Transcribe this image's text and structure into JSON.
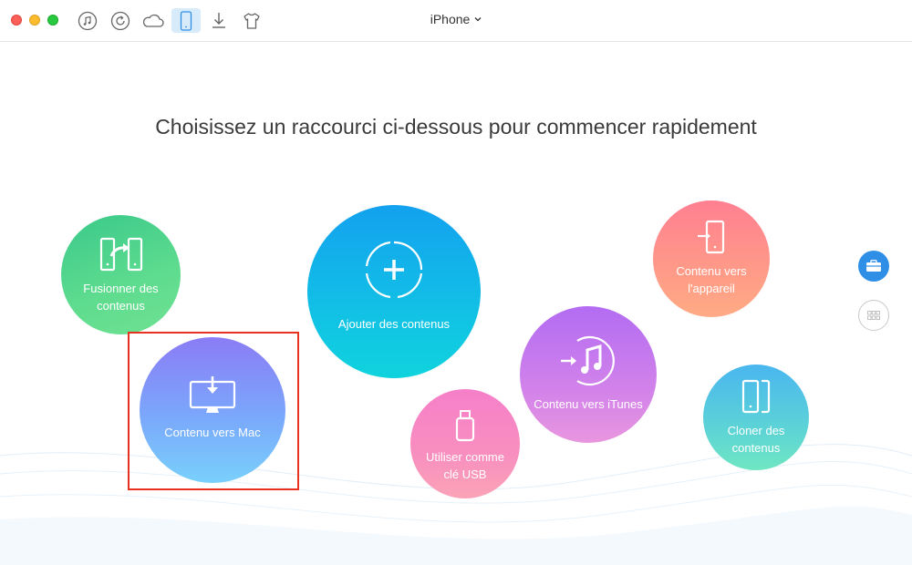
{
  "window": {
    "device_name": "iPhone"
  },
  "toolbar": {
    "items": [
      {
        "name": "music-icon",
        "active": false
      },
      {
        "name": "backup-icon",
        "active": false
      },
      {
        "name": "cloud-icon",
        "active": false
      },
      {
        "name": "iphone-icon",
        "active": true
      },
      {
        "name": "download-icon",
        "active": false
      },
      {
        "name": "tshirt-icon",
        "active": false
      }
    ]
  },
  "main": {
    "headline": "Choisissez un raccourci ci-dessous pour commencer rapidement",
    "shortcuts": {
      "fusion": {
        "line1": "Fusionner des",
        "line2": "contenus",
        "icon": "merge-icon"
      },
      "ajouter": {
        "line1": "Ajouter des contenus",
        "icon": "add-icon"
      },
      "mac": {
        "line1": "Contenu vers Mac",
        "icon": "computer-download-icon"
      },
      "usb": {
        "line1": "Utiliser comme",
        "line2": "clé USB",
        "icon": "usb-icon"
      },
      "itunes": {
        "line1": "Contenu vers iTunes",
        "icon": "itunes-icon"
      },
      "appareil": {
        "line1": "Contenu vers",
        "line2": "l'appareil",
        "icon": "phone-transfer-icon"
      },
      "cloner": {
        "line1": "Cloner des",
        "line2": "contenus",
        "icon": "clone-icon"
      }
    },
    "selected_shortcut": "mac"
  },
  "sidebar": {
    "buttons": [
      {
        "name": "toolkit-icon",
        "active": true
      },
      {
        "name": "grid-icon",
        "active": false
      }
    ]
  },
  "colors": {
    "highlight": "#e8321f",
    "accent": "#2f8fe6"
  }
}
